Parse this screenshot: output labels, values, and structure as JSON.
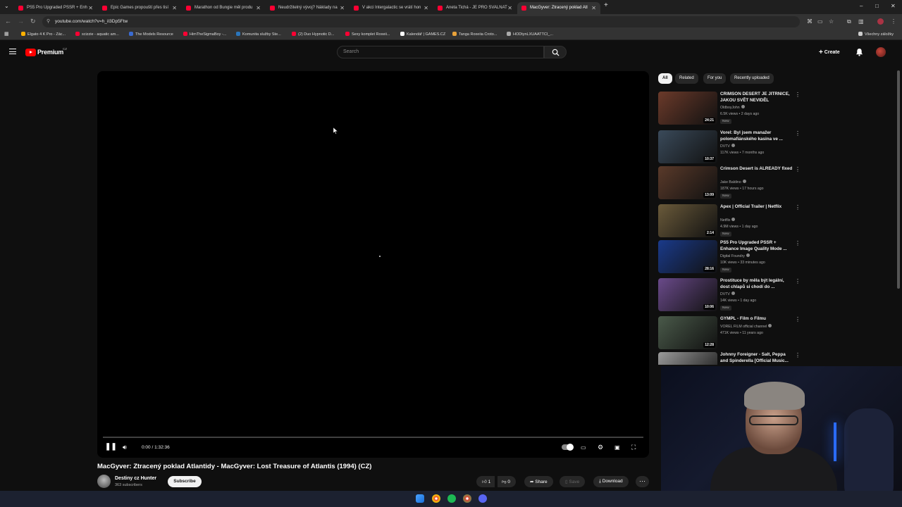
{
  "browser": {
    "tabs": [
      {
        "label": "PS5 Pro Upgraded PSSR + Enh"
      },
      {
        "label": "Epic Games propouští přes tisí"
      },
      {
        "label": "Marathon od Bungie měl produ"
      },
      {
        "label": "Neudržitelný vývoj? Náklady na"
      },
      {
        "label": "V akci Intergalactic se vrátí hon"
      },
      {
        "label": "Aneta Tichá - JE PRO SVALNAT"
      },
      {
        "label": "MacGyver: Ztracený poklad Atl"
      }
    ],
    "url": "youtube.com/watch?v=h_iI3Dp5Ftw",
    "bookmarks": [
      {
        "label": "Elgato 4 K Pro - Zác...",
        "color": "#ffb000"
      },
      {
        "label": "scizzie - aquatic am...",
        "color": "#ff0033"
      },
      {
        "label": "The Models Resource",
        "color": "#3a6bd1"
      },
      {
        "label": "HimTheSigmaBoy -...",
        "color": "#ff0033"
      },
      {
        "label": "Komunita služby Ste...",
        "color": "#2a75bb"
      },
      {
        "label": "(2) Duo Hypnotic D...",
        "color": "#ff0033"
      },
      {
        "label": "Sexy komplet Roxeii...",
        "color": "#ff0033"
      },
      {
        "label": "Kalendář | GAMES.CZ",
        "color": "#ffffff"
      },
      {
        "label": "Tanga Roxeiia Croto...",
        "color": "#e8a23a"
      },
      {
        "label": "HODtynLXUAATTCI_...",
        "color": "#aaaaaa"
      }
    ],
    "all_bookmarks": "Všechny záložky"
  },
  "header": {
    "logo_text": "Premium",
    "logo_badge": "CZ",
    "search_placeholder": "Search",
    "create_label": "Create"
  },
  "player": {
    "time": "0:00 / 1:32:36",
    "progress": 0
  },
  "video": {
    "title": "MacGyver: Ztracený poklad Atlantidy - MacGyver: Lost Treasure of Atlantis (1994) (CZ)",
    "channel": "Destiny cz Hunter",
    "subscribers": "363 subscribers",
    "subscribe_label": "Subscribe",
    "likes": "1",
    "dislikes": "0",
    "share_label": "Share",
    "save_label": "Save",
    "download_label": "Download"
  },
  "chips": [
    "All",
    "Related",
    "For you",
    "Recently uploaded"
  ],
  "recommendations": [
    {
      "title": "CRIMSON DESERT JE JITRNICE, JAKOU SVĚT NEVIDĚL",
      "channel": "OldboyJohn",
      "meta": "6.5K views • 2 days ago",
      "badge": "New",
      "duration": "24:21",
      "thumb_color": "#6b3a2a"
    },
    {
      "title": "Vorel: Byl jsem manažer polomafiánského kasina ve ...",
      "channel": "DVTV",
      "meta": "117K views • 7 months ago",
      "badge": "",
      "duration": "10:37",
      "thumb_color": "#3a4a5a"
    },
    {
      "title": "Crimson Desert is ALREADY fixed",
      "channel": "Jake Baldino",
      "meta": "187K views • 17 hours ago",
      "badge": "New",
      "duration": "13:09",
      "thumb_color": "#5a3a2a"
    },
    {
      "title": "Apex | Official Trailer | Netflix",
      "channel": "Netflix",
      "meta": "4.9M views • 1 day ago",
      "badge": "New",
      "duration": "2:14",
      "thumb_color": "#6a5a3a"
    },
    {
      "title": "PS5 Pro Upgraded PSSR + Enhance Image Quality Mode ...",
      "channel": "Digital Foundry",
      "meta": "10K views • 33 minutes ago",
      "badge": "New",
      "duration": "28:16",
      "thumb_color": "#1a3a8a"
    },
    {
      "title": "Prostituce by měla být legální, dost chlapů si chodí do ...",
      "channel": "DVTV",
      "meta": "14K views • 1 day ago",
      "badge": "New",
      "duration": "10:06",
      "thumb_color": "#6a4a8a"
    },
    {
      "title": "GYMPL - Film o Filmu",
      "channel": "VOREL FILM official channel",
      "meta": "471K views • 11 years ago",
      "badge": "",
      "duration": "12:28",
      "thumb_color": "#4a5a4a"
    },
    {
      "title": "Johnny Foreigner - Salt, Peppa and Spinderella [Official Music...",
      "channel": "",
      "meta": "",
      "badge": "",
      "duration": "",
      "thumb_color": "#9a9a9a"
    }
  ]
}
